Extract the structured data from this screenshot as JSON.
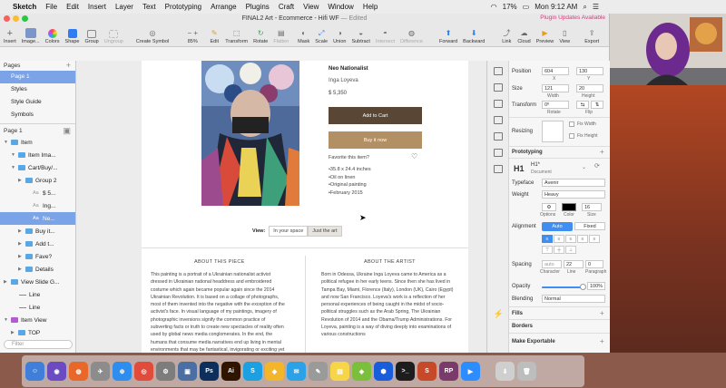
{
  "menubar": {
    "app": "Sketch",
    "items": [
      "File",
      "Edit",
      "Insert",
      "Layer",
      "Text",
      "Prototyping",
      "Arrange",
      "Plugins",
      "Craft",
      "View",
      "Window",
      "Help"
    ],
    "battery": "17%",
    "clock": "Mon 9:12 AM"
  },
  "window": {
    "title": "FINAL2 Art - Ecommerce - Hifi WF",
    "title_status": "— Edited",
    "plugin_notice": "Plugin Updates Available"
  },
  "toolbar": {
    "insert": "Insert",
    "image": "Image...",
    "colors": "Colors",
    "shape": "Shape",
    "group": "Group",
    "ungroup": "Ungroup",
    "create_symbol": "Create Symbol",
    "zoom": "85%",
    "edit": "Edit",
    "transform": "Transform",
    "rotate": "Rotate",
    "flatten": "Flatten",
    "mask": "Mask",
    "scale": "Scale",
    "union": "Union",
    "subtract": "Subtract",
    "intersect": "Intersect",
    "difference": "Difference",
    "forward": "Forward",
    "backward": "Backward",
    "link": "Link",
    "cloud": "Cloud",
    "preview": "Preview",
    "view": "View",
    "export": "Export"
  },
  "pages": {
    "header": "Pages",
    "items": [
      "Page 1",
      "Styles",
      "Style Guide",
      "Symbols"
    ]
  },
  "layers": {
    "header": "Page 1",
    "rows": [
      {
        "label": "Item",
        "kind": "folder",
        "indent": 0
      },
      {
        "label": "Item Ima...",
        "kind": "folder",
        "indent": 1
      },
      {
        "label": "Cart/Buy/...",
        "kind": "folder",
        "indent": 1
      },
      {
        "label": "Group 2",
        "kind": "folder",
        "indent": 2
      },
      {
        "label": "$ 5...",
        "kind": "text",
        "indent": 3
      },
      {
        "label": "Ing...",
        "kind": "text",
        "indent": 3
      },
      {
        "label": "Ne...",
        "kind": "text",
        "indent": 3,
        "selected": true
      },
      {
        "label": "Buy it...",
        "kind": "folder",
        "indent": 2
      },
      {
        "label": "Add t...",
        "kind": "folder",
        "indent": 2
      },
      {
        "label": "Fave?",
        "kind": "folder",
        "indent": 2
      },
      {
        "label": "Details",
        "kind": "folder",
        "indent": 2
      },
      {
        "label": "View Slide G...",
        "kind": "folder",
        "indent": 0
      },
      {
        "label": "Line",
        "kind": "line",
        "indent": 1
      },
      {
        "label": "Line",
        "kind": "line",
        "indent": 1
      },
      {
        "label": "Item View",
        "kind": "symbol",
        "indent": 0,
        "expanded": true
      },
      {
        "label": "TOP",
        "kind": "folder",
        "indent": 1
      },
      {
        "label": "FOOTER",
        "kind": "folder",
        "indent": 1
      }
    ],
    "filter_placeholder": "Filter"
  },
  "canvas": {
    "product_name": "Neo Nationalist",
    "artist": "Inga Loyeva",
    "price": "$ 5,350",
    "add_to_cart": "Add to Cart",
    "buy_now": "Buy it now",
    "favorite_prompt": "Favorite this item?",
    "specs": [
      "•35.8 x 24.4 inches",
      "•Oil on linen",
      "•Original painting",
      "•February 2015"
    ],
    "view_label": "View:",
    "view_options": [
      "In your space",
      "Just the art"
    ],
    "view_active": "Just the art",
    "about_piece_title": "ABOUT THIS PIECE",
    "about_piece_text": "This painting is a portrait of a Ukrainian nationalist activist dressed in Ukrainian national headdress and embroidered costume which again became popular again since the 2014 Ukrainian Revolution. It is based on a collage of photographs, most of them invented into the negative with the exception of the activist's face. In visual language of my paintings, imagery of photographic inversions signify the common practice of subverting facts or truth to create new spectacles of reality often used by global news media conglomerates. In the end, the humans that consume media narratives end up living in mental environments that may be fantastical, invigorating or exciting yet do not reflect objective states of the world.",
    "about_artist_title": "ABOUT THE ARTIST",
    "about_artist_text": "Born in Odessa, Ukraine Inga Loyeva came to America as a political refugee in her early teens. Since then she has lived in Tampa Bay, Miami, Florence (Italy), London (UK), Cairo (Egypt) and now San Francisco. Loyeva's work is a reflection of her personal experiences of being caught in the midst of socio-political struggles such as the Arab Spring, The Ukrainian Revolution of 2014 and the Obama/Trump Administrations. For Loyeva, painting is a way of diving deeply into examinations of various constructions"
  },
  "inspector": {
    "position_label": "Position",
    "x": "604",
    "y": "130",
    "x_label": "X",
    "y_label": "Y",
    "size_label": "Size",
    "width": "121",
    "height": "20",
    "width_label": "Width",
    "height_label": "Height",
    "transform_label": "Transform",
    "rotate_value": "0º",
    "rotate_label": "Rotate",
    "flip_label": "Flip",
    "resizing_label": "Resizing",
    "fix_width": "Fix Width",
    "fix_height": "Fix Height",
    "prototyping_label": "Prototyping",
    "style_tag": "H1",
    "style_name": "H1*",
    "style_source": "Document",
    "typeface_label": "Typeface",
    "typeface": "Avenir",
    "weight_label": "Weight",
    "weight": "Heavy",
    "options_label": "Options",
    "color_label": "Color",
    "size_label2": "Size",
    "font_size": "16",
    "alignment_label": "Alignment",
    "auto": "Auto",
    "fixed": "Fixed",
    "spacing_label": "Spacing",
    "char_spacing": "auto",
    "line_height": "22",
    "paragraph": "0",
    "character_label": "Character",
    "line_label": "Line",
    "paragraph_label": "Paragraph",
    "opacity_label": "Opacity",
    "opacity": "100%",
    "opacity_value": 1.0,
    "blending_label": "Blending",
    "blending": "Normal",
    "fills_label": "Fills",
    "borders_label": "Borders",
    "make_exportable": "Make Exportable"
  },
  "dock": {
    "apps": [
      "Finder",
      "Siri",
      "Firefox",
      "Launchpad",
      "Safari",
      "Chrome",
      "System Preferences",
      "Preview",
      "Photoshop",
      "Illustrator",
      "Skype",
      "Sketch",
      "Messages",
      "Script Editor",
      "Notes",
      "Android File Transfer",
      "Bitwarden",
      "Terminal",
      "Scrivener",
      "RP",
      "Zoom",
      "Downloads",
      "Trash"
    ]
  },
  "colors": {
    "selection": "#7aa3e8",
    "accent": "#3f8ef0",
    "cart_button": "#5a4634",
    "buy_button": "#b39064"
  }
}
